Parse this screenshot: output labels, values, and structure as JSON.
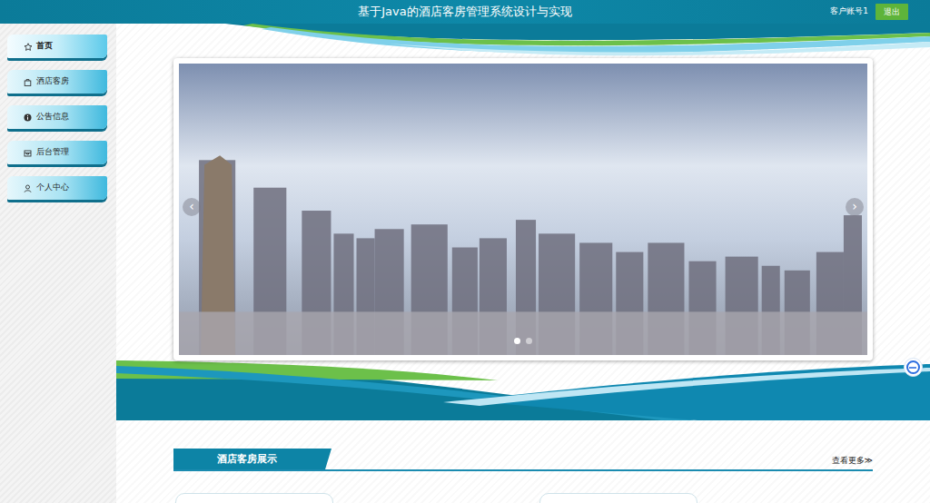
{
  "header": {
    "title": "基于Java的酒店客房管理系统设计与实现",
    "user": "客户账号1",
    "logout": "退出"
  },
  "sidebar": {
    "items": [
      {
        "label": "首页",
        "selected": true
      },
      {
        "label": "酒店客房",
        "selected": false
      },
      {
        "label": "公告信息",
        "selected": false
      },
      {
        "label": "后台管理",
        "selected": false
      },
      {
        "label": "个人中心",
        "selected": false
      }
    ]
  },
  "carousel": {
    "prev": "‹",
    "next": "›",
    "slides": [
      {
        "selected": true
      },
      {
        "selected": false
      }
    ]
  },
  "section": {
    "title": "酒店客房展示",
    "more": "查看更多≫"
  }
}
